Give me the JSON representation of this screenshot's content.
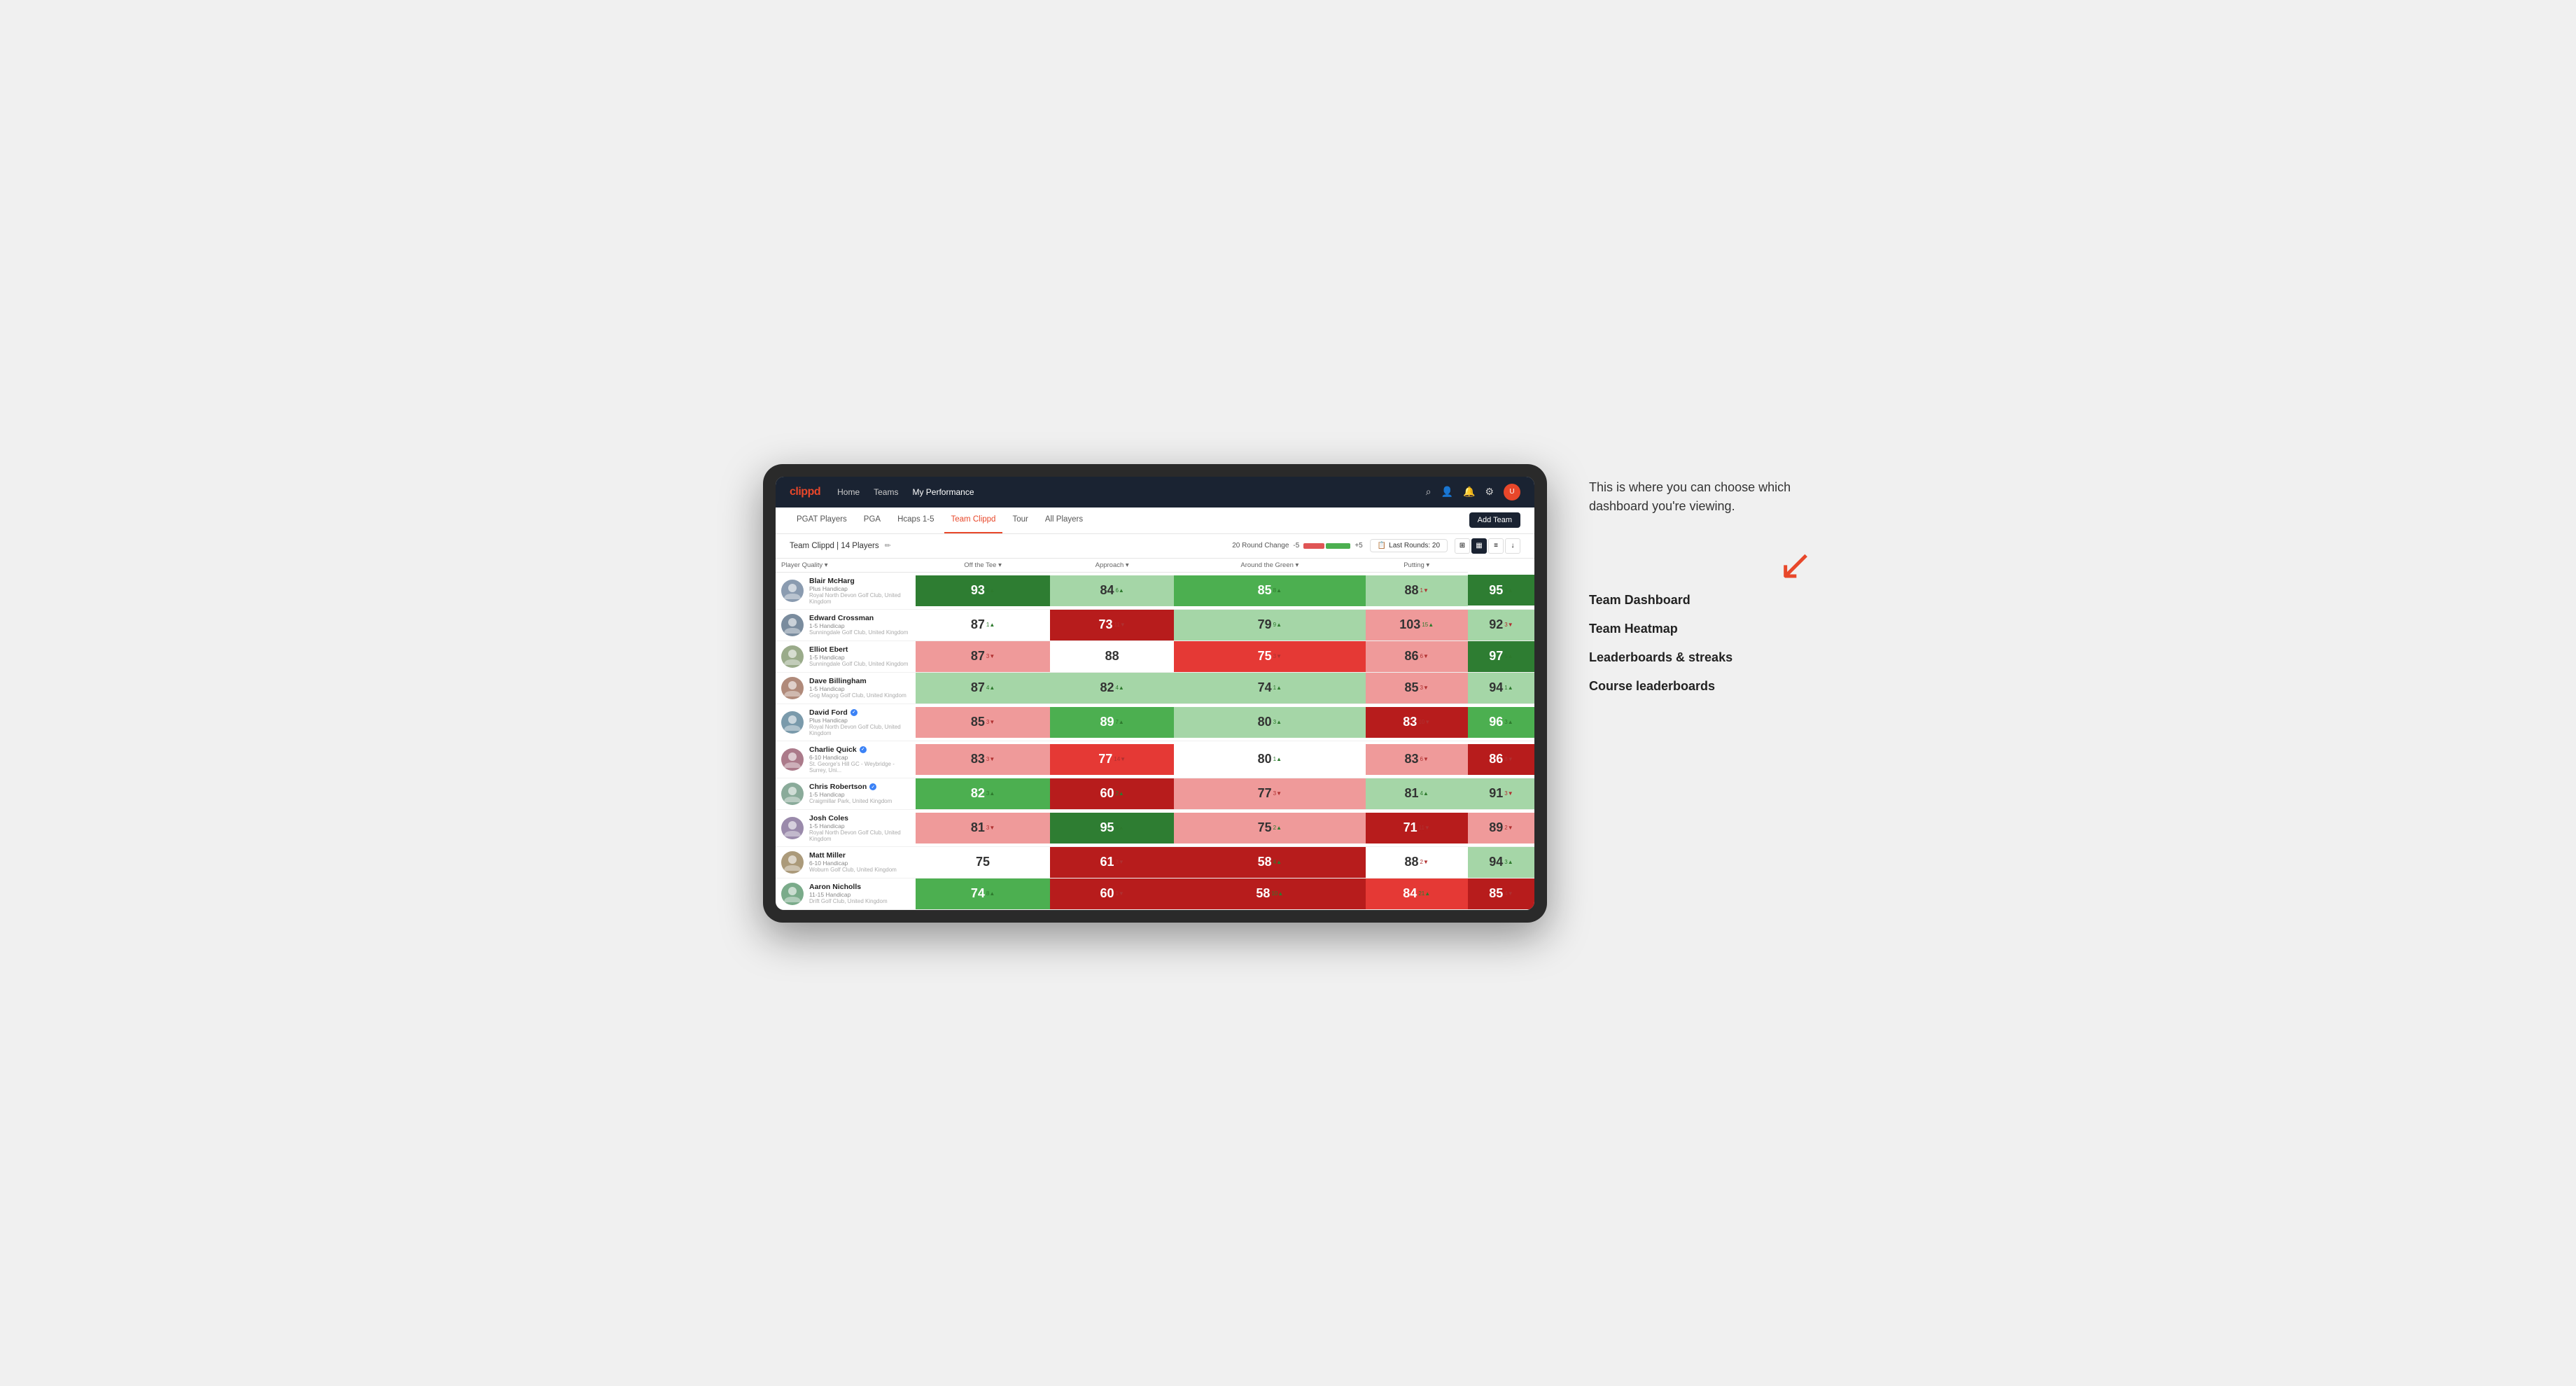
{
  "callout": "This is where you can choose which dashboard you're viewing.",
  "menu_options": [
    "Team Dashboard",
    "Team Heatmap",
    "Leaderboards & streaks",
    "Course leaderboards"
  ],
  "nav": {
    "logo": "clippd",
    "items": [
      "Home",
      "Teams",
      "My Performance"
    ],
    "active": "My Performance"
  },
  "sub_nav": {
    "items": [
      "PGAT Players",
      "PGA",
      "Hcaps 1-5",
      "Team Clippd",
      "Tour",
      "All Players"
    ],
    "active": "Team Clippd",
    "add_team_label": "Add Team"
  },
  "team_header": {
    "title": "Team Clippd | 14 Players",
    "round_change_label": "20 Round Change",
    "change_minus": "-5",
    "change_plus": "+5",
    "last_rounds_label": "Last Rounds: 20"
  },
  "table": {
    "col_header_player": "Player Quality ▾",
    "col_header_tee": "Off the Tee ▾",
    "col_header_approach": "Approach ▾",
    "col_header_around": "Around the Green ▾",
    "col_header_putting": "Putting ▾",
    "players": [
      {
        "name": "Blair McHarg",
        "handicap": "Plus Handicap",
        "club": "Royal North Devon Golf Club, United Kingdom",
        "verified": false,
        "scores": [
          {
            "value": 93,
            "change": 4,
            "dir": "up",
            "color": "bg-green-dark"
          },
          {
            "value": 84,
            "change": 6,
            "dir": "up",
            "color": "bg-green-light"
          },
          {
            "value": 85,
            "change": 8,
            "dir": "up",
            "color": "bg-green-med"
          },
          {
            "value": 88,
            "change": 1,
            "dir": "down",
            "color": "bg-green-light"
          },
          {
            "value": 95,
            "change": 9,
            "dir": "up",
            "color": "bg-green-dark"
          }
        ]
      },
      {
        "name": "Edward Crossman",
        "handicap": "1-5 Handicap",
        "club": "Sunningdale Golf Club, United Kingdom",
        "verified": false,
        "scores": [
          {
            "value": 87,
            "change": 1,
            "dir": "up",
            "color": "bg-white"
          },
          {
            "value": 73,
            "change": 11,
            "dir": "down",
            "color": "bg-red-dark"
          },
          {
            "value": 79,
            "change": 9,
            "dir": "up",
            "color": "bg-green-light"
          },
          {
            "value": 103,
            "change": 15,
            "dir": "up",
            "color": "bg-red-light"
          },
          {
            "value": 92,
            "change": 3,
            "dir": "down",
            "color": "bg-green-light"
          }
        ]
      },
      {
        "name": "Elliot Ebert",
        "handicap": "1-5 Handicap",
        "club": "Sunningdale Golf Club, United Kingdom",
        "verified": false,
        "scores": [
          {
            "value": 87,
            "change": 3,
            "dir": "down",
            "color": "bg-red-light"
          },
          {
            "value": 88,
            "change": null,
            "dir": null,
            "color": "bg-white"
          },
          {
            "value": 75,
            "change": 3,
            "dir": "down",
            "color": "bg-red-med"
          },
          {
            "value": 86,
            "change": 6,
            "dir": "down",
            "color": "bg-red-light"
          },
          {
            "value": 97,
            "change": 5,
            "dir": "up",
            "color": "bg-green-dark"
          }
        ]
      },
      {
        "name": "Dave Billingham",
        "handicap": "1-5 Handicap",
        "club": "Gog Magog Golf Club, United Kingdom",
        "verified": false,
        "scores": [
          {
            "value": 87,
            "change": 4,
            "dir": "up",
            "color": "bg-green-light"
          },
          {
            "value": 82,
            "change": 4,
            "dir": "up",
            "color": "bg-green-light"
          },
          {
            "value": 74,
            "change": 1,
            "dir": "up",
            "color": "bg-green-light"
          },
          {
            "value": 85,
            "change": 3,
            "dir": "down",
            "color": "bg-red-light"
          },
          {
            "value": 94,
            "change": 1,
            "dir": "up",
            "color": "bg-green-light"
          }
        ]
      },
      {
        "name": "David Ford",
        "handicap": "Plus Handicap",
        "club": "Royal North Devon Golf Club, United Kingdom",
        "verified": true,
        "scores": [
          {
            "value": 85,
            "change": 3,
            "dir": "down",
            "color": "bg-red-light"
          },
          {
            "value": 89,
            "change": 7,
            "dir": "up",
            "color": "bg-green-med"
          },
          {
            "value": 80,
            "change": 3,
            "dir": "up",
            "color": "bg-green-light"
          },
          {
            "value": 83,
            "change": 10,
            "dir": "down",
            "color": "bg-red-dark"
          },
          {
            "value": 96,
            "change": 3,
            "dir": "up",
            "color": "bg-green-med"
          }
        ]
      },
      {
        "name": "Charlie Quick",
        "handicap": "6-10 Handicap",
        "club": "St. George's Hill GC - Weybridge - Surrey, Uni...",
        "verified": true,
        "scores": [
          {
            "value": 83,
            "change": 3,
            "dir": "down",
            "color": "bg-red-light"
          },
          {
            "value": 77,
            "change": 14,
            "dir": "down",
            "color": "bg-red-med"
          },
          {
            "value": 80,
            "change": 1,
            "dir": "up",
            "color": "bg-white"
          },
          {
            "value": 83,
            "change": 6,
            "dir": "down",
            "color": "bg-red-light"
          },
          {
            "value": 86,
            "change": 8,
            "dir": "down",
            "color": "bg-red-dark"
          }
        ]
      },
      {
        "name": "Chris Robertson",
        "handicap": "1-5 Handicap",
        "club": "Craigmillar Park, United Kingdom",
        "verified": true,
        "scores": [
          {
            "value": 82,
            "change": 3,
            "dir": "up",
            "color": "bg-green-med"
          },
          {
            "value": 60,
            "change": 2,
            "dir": "up",
            "color": "bg-red-dark"
          },
          {
            "value": 77,
            "change": 3,
            "dir": "down",
            "color": "bg-red-light"
          },
          {
            "value": 81,
            "change": 4,
            "dir": "up",
            "color": "bg-green-light"
          },
          {
            "value": 91,
            "change": 3,
            "dir": "down",
            "color": "bg-green-light"
          }
        ]
      },
      {
        "name": "Josh Coles",
        "handicap": "1-5 Handicap",
        "club": "Royal North Devon Golf Club, United Kingdom",
        "verified": false,
        "scores": [
          {
            "value": 81,
            "change": 3,
            "dir": "down",
            "color": "bg-red-light"
          },
          {
            "value": 95,
            "change": 8,
            "dir": "up",
            "color": "bg-green-dark"
          },
          {
            "value": 75,
            "change": 2,
            "dir": "up",
            "color": "bg-red-light"
          },
          {
            "value": 71,
            "change": 11,
            "dir": "down",
            "color": "bg-red-dark"
          },
          {
            "value": 89,
            "change": 2,
            "dir": "down",
            "color": "bg-red-light"
          }
        ]
      },
      {
        "name": "Matt Miller",
        "handicap": "6-10 Handicap",
        "club": "Woburn Golf Club, United Kingdom",
        "verified": false,
        "scores": [
          {
            "value": 75,
            "change": null,
            "dir": null,
            "color": "bg-white"
          },
          {
            "value": 61,
            "change": 3,
            "dir": "down",
            "color": "bg-red-dark"
          },
          {
            "value": 58,
            "change": 4,
            "dir": "up",
            "color": "bg-red-dark"
          },
          {
            "value": 88,
            "change": 2,
            "dir": "down",
            "color": "bg-white"
          },
          {
            "value": 94,
            "change": 3,
            "dir": "up",
            "color": "bg-green-light"
          }
        ]
      },
      {
        "name": "Aaron Nicholls",
        "handicap": "11-15 Handicap",
        "club": "Drift Golf Club, United Kingdom",
        "verified": false,
        "scores": [
          {
            "value": 74,
            "change": 8,
            "dir": "up",
            "color": "bg-green-med"
          },
          {
            "value": 60,
            "change": 1,
            "dir": "down",
            "color": "bg-red-dark"
          },
          {
            "value": 58,
            "change": 10,
            "dir": "up",
            "color": "bg-red-dark"
          },
          {
            "value": 84,
            "change": 21,
            "dir": "up",
            "color": "bg-red-med"
          },
          {
            "value": 85,
            "change": 4,
            "dir": "down",
            "color": "bg-red-dark"
          }
        ]
      }
    ]
  },
  "colors": {
    "nav_bg": "#1a2332",
    "logo_red": "#e8472a",
    "active_tab": "#e8472a"
  }
}
